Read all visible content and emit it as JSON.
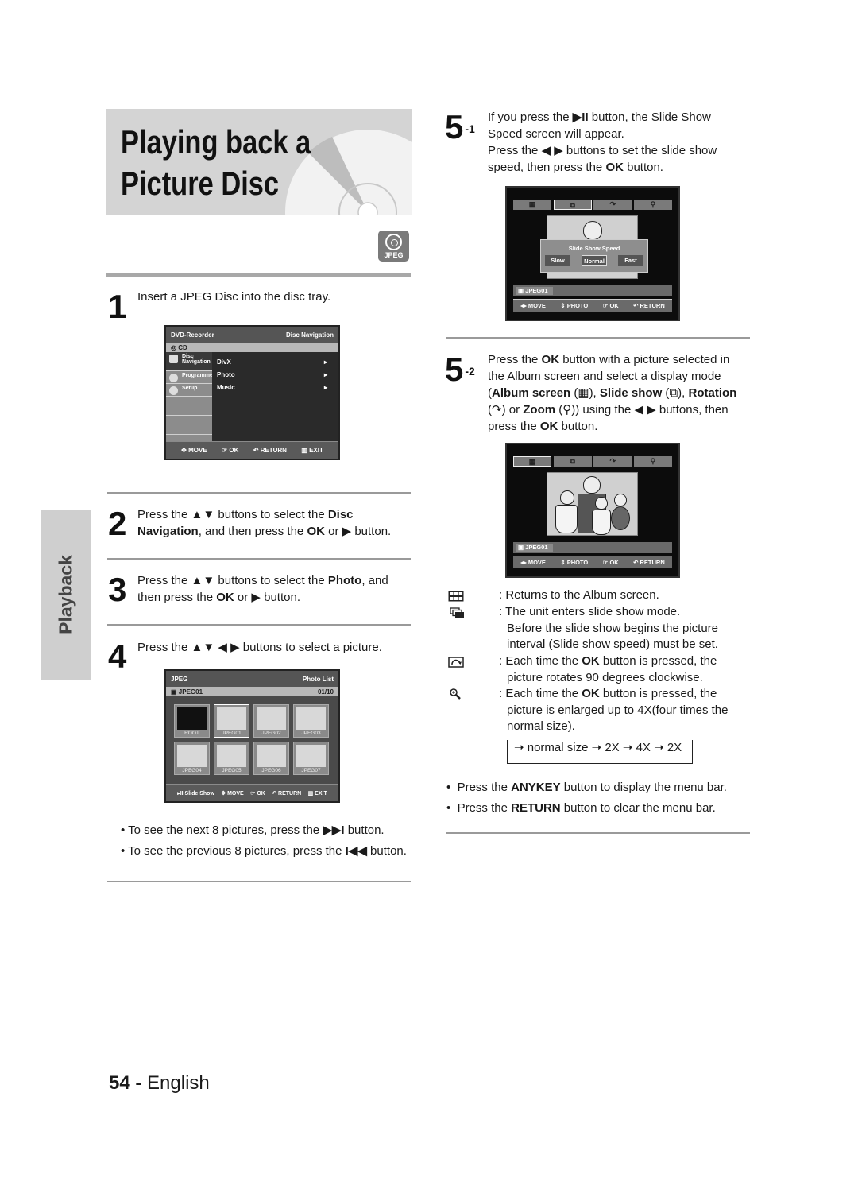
{
  "title": {
    "line1": "Playing back a",
    "line2": "Picture Disc"
  },
  "badge": "JPEG",
  "side_tab": "Playback",
  "steps": {
    "s1": {
      "num": "1",
      "text": "Insert a JPEG Disc into the disc tray."
    },
    "s2": {
      "num": "2",
      "p1": "Press the ",
      "arrows": "▲▼",
      "p2": " buttons to select the ",
      "b1": "Disc Navigation",
      "p3": ", and then press the ",
      "b2": "OK",
      "p4": " or ▶ button."
    },
    "s3": {
      "num": "3",
      "p1": "Press the ",
      "arrows": "▲▼",
      "p2": " buttons to select the ",
      "b1": "Photo",
      "p3": ", and then press the ",
      "b2": "OK",
      "p4": " or ▶ button."
    },
    "s4": {
      "num": "4",
      "text": "Press the ▲▼ ◀ ▶ buttons to select a picture."
    },
    "s51": {
      "num": "5",
      "sup": "-1",
      "p1": "If you press the ",
      "b1": "▶II",
      "p2": " button, the Slide Show Speed screen will appear.",
      "p3": "Press the ◀ ▶ buttons to set the slide show speed, then press the ",
      "b2": "OK",
      "p4": " button."
    },
    "s52": {
      "num": "5",
      "sup": "-2",
      "p1": "Press the ",
      "b1": "OK",
      "p2": " button with a picture selected in the Album screen and select a display mode (",
      "b2": "Album screen",
      "p3": " (",
      "p4": "), ",
      "b3": "Slide show",
      "p5": " (",
      "p6": "), ",
      "b4": "Rotation",
      "p7": " (",
      "p8": ") or ",
      "b5": "Zoom",
      "p9": " (",
      "p10": ")) using the ◀ ▶ buttons, then press the ",
      "b6": "OK",
      "p11": " button."
    }
  },
  "osd_disc_nav": {
    "header_left": "DVD-Recorder",
    "header_right": "Disc Navigation",
    "source": "CD",
    "side_items": [
      "Disc Navigation",
      "Programme",
      "Setup"
    ],
    "menu_items": [
      "DivX",
      "Photo",
      "Music"
    ],
    "footer": [
      "MOVE",
      "OK",
      "RETURN",
      "EXIT"
    ]
  },
  "osd_photo_list": {
    "header_left": "JPEG",
    "header_right": "Photo List",
    "folder": "JPEG01",
    "page": "01/10",
    "thumbs": [
      "ROOT",
      "JPEG01",
      "JPEG02",
      "JPEG03",
      "JPEG04",
      "JPEG05",
      "JPEG06",
      "JPEG07"
    ],
    "footer": [
      "Slide Show",
      "MOVE",
      "OK",
      "RETURN",
      "EXIT"
    ]
  },
  "osd_slide_speed": {
    "dialog_title": "Slide Show Speed",
    "options": [
      "Slow",
      "Normal",
      "Fast"
    ],
    "selected": "Normal",
    "file": "JPEG01",
    "footer": [
      "MOVE",
      "PHOTO",
      "OK",
      "RETURN"
    ]
  },
  "osd_album": {
    "file": "JPEG01",
    "footer": [
      "MOVE",
      "PHOTO",
      "OK",
      "RETURN"
    ]
  },
  "legend": [
    {
      "icon": "album-grid-icon",
      "lines": [
        ": Returns to the Album screen."
      ]
    },
    {
      "icon": "slide-show-icon",
      "lines": [
        ": The unit enters slide show mode.",
        "Before the slide show begins the picture",
        "interval (Slide show speed) must be set."
      ]
    },
    {
      "icon": "rotate-icon",
      "pre": ": Each time the ",
      "bold": "OK",
      "post": " button is pressed, the",
      "lines": [
        "picture rotates 90 degrees clockwise."
      ]
    },
    {
      "icon": "zoom-icon",
      "pre": ": Each time the ",
      "bold": "OK",
      "post": " button is pressed, the",
      "lines": [
        "picture is enlarged up to 4X(four times the",
        "normal size)."
      ]
    }
  ],
  "zoom_cycle": "➝ normal size ➝ 2X ➝ 4X ➝ 2X",
  "notes_left": [
    {
      "pre": "To see the next 8 pictures, press the ",
      "icon": "▶▶I",
      "post": " button."
    },
    {
      "pre": "To see the previous 8 pictures, press the ",
      "icon": "I◀◀",
      "post": " button."
    }
  ],
  "notes_right": [
    {
      "pre": "Press the ",
      "bold": "ANYKEY",
      "post": " button to display the menu bar."
    },
    {
      "pre": "Press the ",
      "bold": "RETURN",
      "post": " button to clear the menu bar."
    }
  ],
  "footer": {
    "page": "54 -",
    "lang": "English"
  }
}
